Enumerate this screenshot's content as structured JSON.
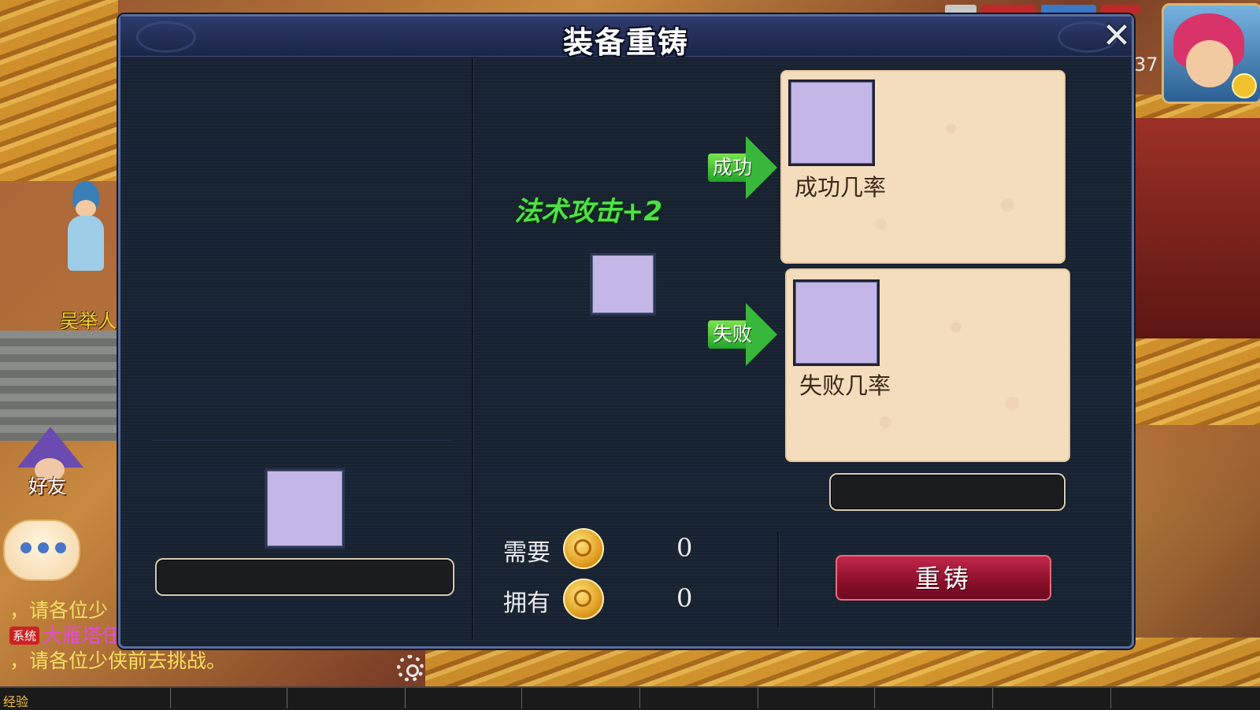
{
  "dialog": {
    "title": "装备重铸",
    "attribute_preview": "法术攻击+2",
    "success_arrow_label": "成功",
    "fail_arrow_label": "失败",
    "success_card_label": "成功几率",
    "fail_card_label": "失败几率",
    "cost": {
      "required_label": "需要",
      "required_value": "0",
      "owned_label": "拥有",
      "owned_value": "0"
    },
    "recast_button_label": "重铸"
  },
  "world": {
    "npc_name": "吴举人",
    "friend_label": "好友",
    "level_partial": "37"
  },
  "chat": {
    "line1": "，请各位少",
    "system_tag": "系统",
    "line2": "大雁塔任务即将在大雁塔一层降临",
    "line3": "，请各位少侠前去挑战。"
  },
  "hud": {
    "exp_label": "经验"
  },
  "colors": {
    "attribute_green": "#4de04a",
    "recast_button": "#8a0f2a",
    "card_background": "#f4ddbd",
    "slot_placeholder": "#c4b6e6"
  },
  "icons": [
    "close-icon",
    "coin-icon",
    "gear-icon",
    "chat-icon",
    "arrow-right-icon"
  ]
}
